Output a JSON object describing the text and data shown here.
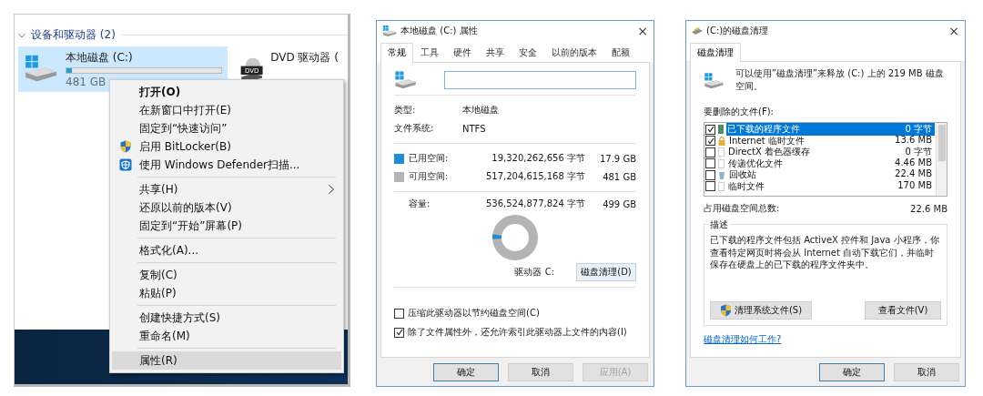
{
  "explorer": {
    "group": {
      "label": "设备和驱动器 (2)",
      "expanded": true
    },
    "drives": [
      {
        "kind": "disk",
        "name": "本地磁盘 (C:)",
        "level": 0.036,
        "info": "481 GB",
        "selected": true
      },
      {
        "kind": "dvd",
        "name": "DVD 驱动器 (",
        "badge": "DVD",
        "selected": false
      }
    ]
  },
  "context_menu": {
    "sections": [
      [
        {
          "label": "打开(O)",
          "bold": true,
          "selected": false
        },
        {
          "label": "在新窗口中打开(E)",
          "selected": false
        },
        {
          "label": "固定到“快速访问”",
          "selected": false
        },
        {
          "label": "启用 BitLocker(B)",
          "kind": "shield",
          "selected": false
        },
        {
          "label": "使用 Windows Defender扫描...",
          "kind": "defender",
          "selected": false
        }
      ],
      [
        {
          "label": "共享(H)",
          "submenu": true,
          "selected": false
        },
        {
          "label": "还原以前的版本(V)",
          "selected": false
        },
        {
          "label": "固定到“开始”屏幕(P)",
          "selected": false
        }
      ],
      [
        {
          "label": "格式化(A)...",
          "selected": false
        }
      ],
      [
        {
          "label": "复制(C)",
          "selected": false
        },
        {
          "label": "粘贴(P)",
          "selected": false
        }
      ],
      [
        {
          "label": "创建快捷方式(S)",
          "selected": false
        },
        {
          "label": "重命名(M)",
          "selected": false
        }
      ],
      [
        {
          "label": "属性(R)",
          "selected": true
        }
      ]
    ]
  },
  "properties": {
    "title": "本地磁盘 (C:) 属性",
    "close": "×",
    "tabs": [
      {
        "label": "常规",
        "selected": true
      },
      {
        "label": "工具",
        "selected": false
      },
      {
        "label": "硬件",
        "selected": false
      },
      {
        "label": "共享",
        "selected": false
      },
      {
        "label": "安全",
        "selected": false
      },
      {
        "label": "以前的版本",
        "selected": false
      },
      {
        "label": "配额",
        "selected": false
      }
    ],
    "info": [
      {
        "label": "类型:",
        "value": "本地磁盘"
      },
      {
        "label": "文件系统:",
        "value": "NTFS"
      }
    ],
    "space": [
      {
        "label": "已用空间:",
        "bytes": "19,320,262,656 字节",
        "size": "17.9 GB",
        "color": "#1e8fd6"
      },
      {
        "label": "可用空间:",
        "bytes": "517,204,615,168 字节",
        "size": "481 GB",
        "color": "#b4b4b4"
      }
    ],
    "capacity": {
      "label": "容量:",
      "bytes": "536,524,877,824 字节",
      "size": "499 GB"
    },
    "donut": {
      "level": 0.036
    },
    "drive_label": "驱动器 C:",
    "cleanup_button": "磁盘清理(D)",
    "options": [
      {
        "label": "压缩此驱动器以节约磁盘空间(C)",
        "checked": false
      },
      {
        "label": "除了文件属性外，还允许索引此驱动器上文件的内容(I)",
        "checked": true
      }
    ],
    "buttons": [
      {
        "label": "确定",
        "default": true,
        "disabled": false
      },
      {
        "label": "取消",
        "default": false,
        "disabled": false
      },
      {
        "label": "应用(A)",
        "default": false,
        "disabled": true
      }
    ]
  },
  "cleanup": {
    "title": "(C:)的磁盘清理",
    "close": "×",
    "tabs": [
      {
        "label": "磁盘清理",
        "selected": true
      }
    ],
    "message": "可以使用”磁盘清理”来释放  (C:) 上的 219 MB 磁盘空间。",
    "files_label": "要删除的文件(F):",
    "files": [
      {
        "name": "已下载的程序文件",
        "size": "0 字节",
        "checked": true,
        "selected": true,
        "kind": "folder"
      },
      {
        "name": "Internet 临时文件",
        "size": "13.6 MB",
        "checked": true,
        "selected": false,
        "kind": "lock"
      },
      {
        "name": "DirectX 着色器缓存",
        "size": "0 字节",
        "checked": false,
        "selected": false,
        "kind": "file"
      },
      {
        "name": "传递优化文件",
        "size": "4.46 MB",
        "checked": false,
        "selected": false,
        "kind": "file"
      },
      {
        "name": "回收站",
        "size": "22.4 MB",
        "checked": false,
        "selected": false,
        "kind": "bin"
      },
      {
        "name": "临时文件",
        "size": "170 MB",
        "checked": false,
        "selected": false,
        "kind": "file"
      }
    ],
    "total": {
      "label": "占用磁盘空间总数:",
      "value": "22.6 MB"
    },
    "description": {
      "title": "描述",
      "text": "已下载的程序文件包括 ActiveX 控件和 Java 小程序，你查看特定网页时将会从 Internet 自动下载它们，并临时保存在硬盘上的已下载的程序文件夹中。"
    },
    "actions": [
      {
        "label": "清理系统文件(S)",
        "kind": "shield"
      },
      {
        "label": "查看文件(V)",
        "kind": "plain"
      }
    ],
    "link": "磁盘清理如何工作?",
    "buttons": [
      {
        "label": "确定",
        "default": true,
        "disabled": false
      },
      {
        "label": "取消",
        "default": false,
        "disabled": false
      }
    ]
  }
}
